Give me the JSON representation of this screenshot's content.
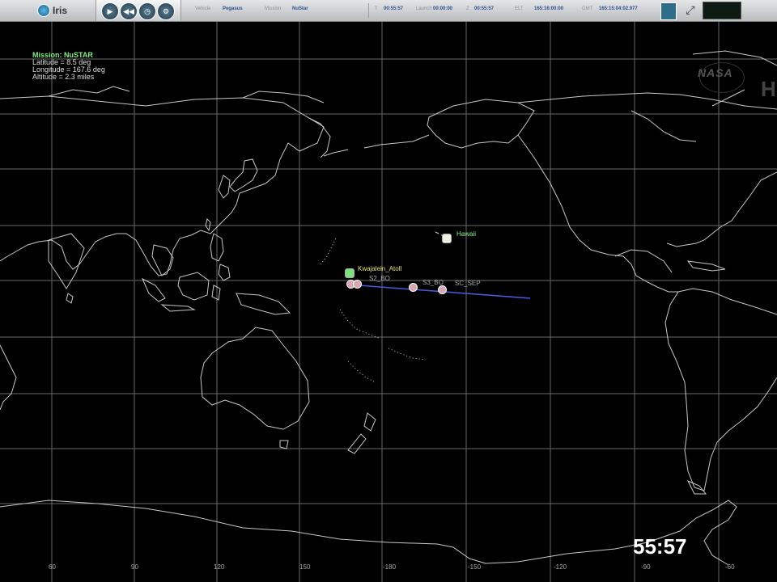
{
  "toolbar": {
    "logo_text": "Iris",
    "buttons": [
      "play-icon",
      "rewind-icon",
      "clock-icon",
      "settings-icon"
    ],
    "fields": [
      {
        "label": "Vehicle",
        "value": "Pegasus"
      },
      {
        "label": "Mission",
        "value": "NuStar"
      },
      {
        "label": "T",
        "value": "00:55:57"
      },
      {
        "label": "Launch",
        "value": "00:00:00"
      },
      {
        "label": "Z",
        "value": "00:55:57"
      },
      {
        "label": "ELT",
        "value": "165:16:00:00"
      },
      {
        "label": "GMT",
        "value": "165:15:04:02.977"
      }
    ]
  },
  "overlay": {
    "mission": "Mission: NuSTAR",
    "latitude": "Latitude = 8.5 deg",
    "longitude": "Longitude = 167.6 deg",
    "altitude": "Altitude = 2.3 miles"
  },
  "map": {
    "sites": [
      {
        "name": "Hawaii"
      },
      {
        "name": "Kwajalein_Atoll"
      }
    ],
    "track_labels": [
      "S2_BO",
      "S3_BO",
      "SC_SEP"
    ],
    "longitude_labels": [
      "60",
      "90",
      "120",
      "150",
      "-180",
      "-150",
      "-120",
      "-90",
      "-60"
    ],
    "track_color": "#4a5ae0",
    "grid_color": "#6a6a6a",
    "coast_color": "#c8c8c8"
  },
  "watermark": {
    "logo": "NASA",
    "hd": "HD"
  },
  "countdown": "55:57"
}
